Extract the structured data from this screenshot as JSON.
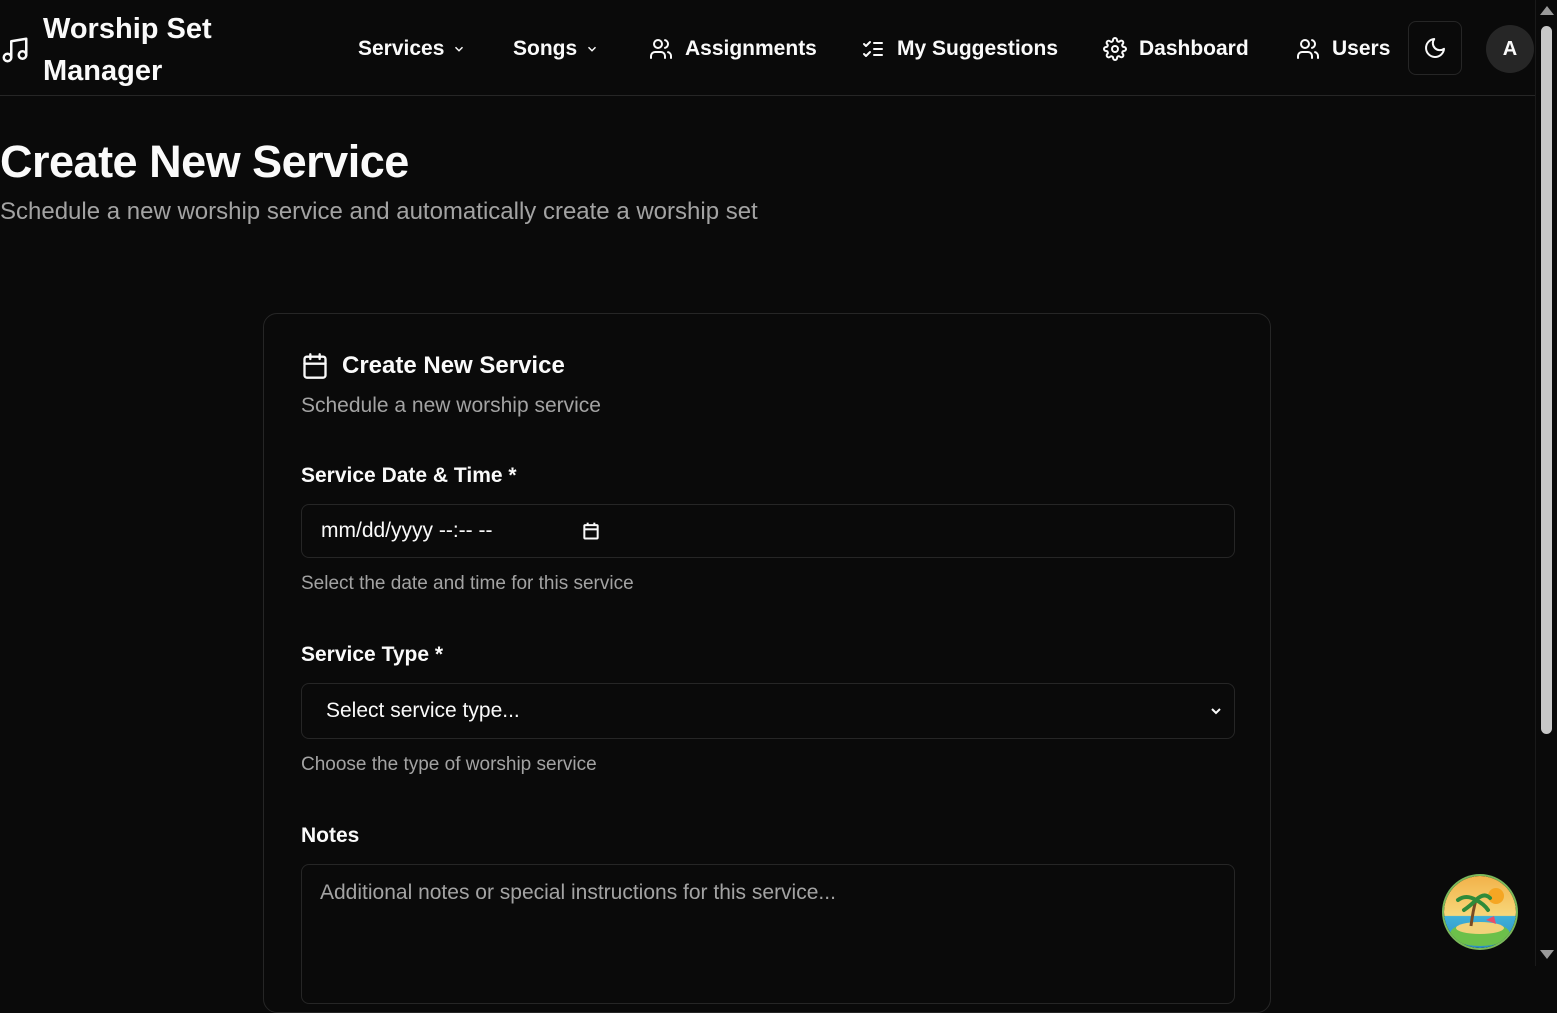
{
  "app": {
    "title_line1": "Worship Set",
    "title_line2": "Manager"
  },
  "nav": {
    "services": "Services",
    "songs": "Songs",
    "assignments": "Assignments",
    "my_suggestions": "My Suggestions",
    "dashboard": "Dashboard",
    "users": "Users"
  },
  "user": {
    "avatar_initial": "A"
  },
  "page": {
    "title": "Create New Service",
    "subtitle": "Schedule a new worship service and automatically create a worship set"
  },
  "card": {
    "title": "Create New Service",
    "subtitle": "Schedule a new worship service",
    "date": {
      "label": "Service Date & Time *",
      "value": "mm/dd/yyyy --:-- --",
      "help": "Select the date and time for this service"
    },
    "type": {
      "label": "Service Type *",
      "value": "Select service type...",
      "help": "Choose the type of worship service"
    },
    "notes": {
      "label": "Notes",
      "placeholder": "Additional notes or special instructions for this service..."
    }
  },
  "icons": {
    "logo": "music-note-icon",
    "theme": "moon-icon",
    "card": "calendar-icon"
  },
  "colors": {
    "background": "#0a0a0a",
    "foreground": "#fafafa",
    "muted": "#a3a3a3",
    "border": "#262626"
  }
}
